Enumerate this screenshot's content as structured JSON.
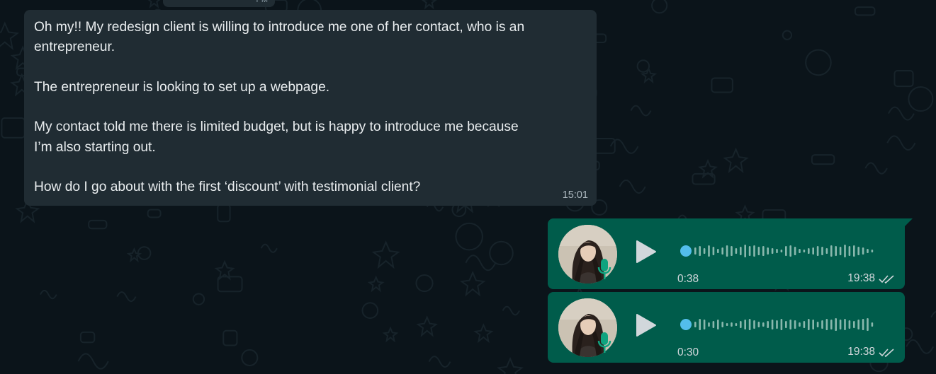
{
  "colors": {
    "background": "#0b141a",
    "incoming_bubble": "#202c33",
    "outgoing_bubble": "#005c4b",
    "waveform_dot": "#53bdeb",
    "mic_icon": "#0fa37f"
  },
  "top_message": {
    "time": "PM"
  },
  "incoming_message": {
    "lines": [
      "Oh my!! My redesign client is willing to introduce me one of her contact, who is an",
      "entrepreneur.",
      "",
      "The entrepreneur is looking to set up a webpage.",
      "",
      "My contact told me there is limited budget, but is happy to introduce me because",
      "I’m also starting out.",
      "",
      "How do I go about with the first ‘discount’ with testimonial client?"
    ],
    "time": "15:01"
  },
  "voice_messages": [
    {
      "duration": "0:38",
      "time": "19:38",
      "status_icon": "double-check-icon",
      "mic_icon": "mic-icon",
      "play_icon": "play-icon",
      "progress": 0
    },
    {
      "duration": "0:30",
      "time": "19:38",
      "status_icon": "double-check-icon",
      "mic_icon": "mic-icon",
      "play_icon": "play-icon",
      "progress": 0
    }
  ]
}
